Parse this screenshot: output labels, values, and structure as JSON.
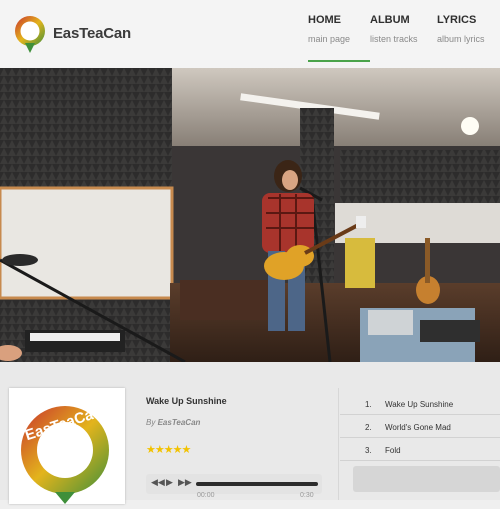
{
  "brand": {
    "name": "EasTeaCan",
    "logo_text": "EasTeaCan"
  },
  "nav": [
    {
      "title": "HOME",
      "sub": "main page",
      "active": true
    },
    {
      "title": "ALBUM",
      "sub": "listen tracks",
      "active": false
    },
    {
      "title": "LYRICS",
      "sub": "album lyrics",
      "active": false
    }
  ],
  "player": {
    "song_title": "Wake Up Sunshine",
    "by_label": "By",
    "artist": "EasTeaCan",
    "rating": 5,
    "stars": "★★★★★",
    "time_current": "00:00",
    "time_total": "0:30"
  },
  "tracks": [
    {
      "num": "1.",
      "name": "Wake Up Sunshine"
    },
    {
      "num": "2.",
      "name": "World's Gone Mad"
    },
    {
      "num": "3.",
      "name": "Fold"
    }
  ],
  "colors": {
    "accent_green": "#4aa34a",
    "logo_red": "#c8322e",
    "logo_yellow": "#e3b41c",
    "logo_green": "#3f8f3a",
    "star": "#f2c200"
  },
  "icons": {
    "prev": "prev-icon",
    "play": "play-icon",
    "next": "next-icon"
  }
}
